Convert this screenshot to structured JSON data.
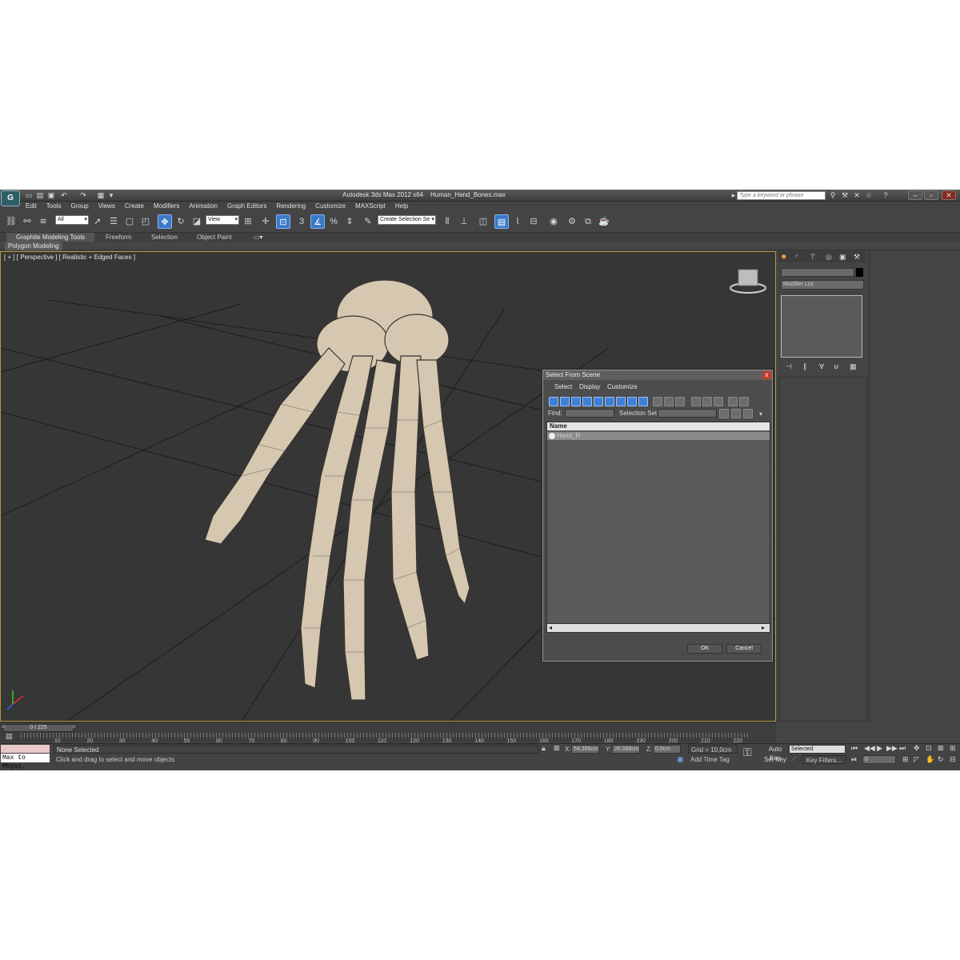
{
  "title": {
    "app": "Autodesk 3ds Max  2012 x64",
    "file": "Human_Hand_Bones.max"
  },
  "logo_text": "G",
  "search": {
    "placeholder": "Type a keyword or phrase"
  },
  "menu": [
    "Edit",
    "Tools",
    "Group",
    "Views",
    "Create",
    "Modifiers",
    "Animation",
    "Graph Editors",
    "Rendering",
    "Customize",
    "MAXScript",
    "Help"
  ],
  "toolbar": {
    "filter": "All",
    "ref_coord": "View",
    "selection_set": "Create Selection Se",
    "snap_number": "3"
  },
  "ribbon_tabs": [
    "Graphite Modeling Tools",
    "Freeform",
    "Selection",
    "Object Paint"
  ],
  "polygon_modeling": "Polygon Modeling",
  "viewport": {
    "label": "[ + ] [ Perspective ] [ Realistic + Edged Faces ]"
  },
  "command_panel": {
    "modifier_list": "Modifier List"
  },
  "dialog": {
    "title": "Select From Scene",
    "close": "x",
    "menu": [
      "Select",
      "Display",
      "Customize"
    ],
    "find_label": "Find:",
    "selection_set_label": "Selection Set:",
    "column_header": "Name",
    "items": [
      "Hand_R"
    ],
    "ok": "OK",
    "cancel": "Cancel"
  },
  "timeline": {
    "position": "0 / 225",
    "ticks": [
      "10",
      "20",
      "30",
      "40",
      "50",
      "60",
      "70",
      "80",
      "90",
      "100",
      "110",
      "120",
      "130",
      "140",
      "150",
      "160",
      "170",
      "180",
      "190",
      "200",
      "210",
      "220"
    ]
  },
  "status": {
    "maxscript": "Max to Physc.",
    "selected": "None Selected",
    "prompt": "Click and drag to select and move objects",
    "x_label": "X:",
    "x": "54,395cm",
    "y_label": "Y:",
    "y": "26,088cm",
    "z_label": "Z:",
    "z": "0,0cm",
    "grid": "Grid = 10,0cm",
    "auto_key": "Auto Key",
    "key_mode": "Selected",
    "set_key": "Set Key",
    "key_filters": "Key Filters...",
    "add_time_tag": "Add Time Tag",
    "frame": "0"
  },
  "colors": {
    "accent": "#3b79c9",
    "viewport_border": "#b59a3a",
    "bone": "#d6c7b0"
  }
}
